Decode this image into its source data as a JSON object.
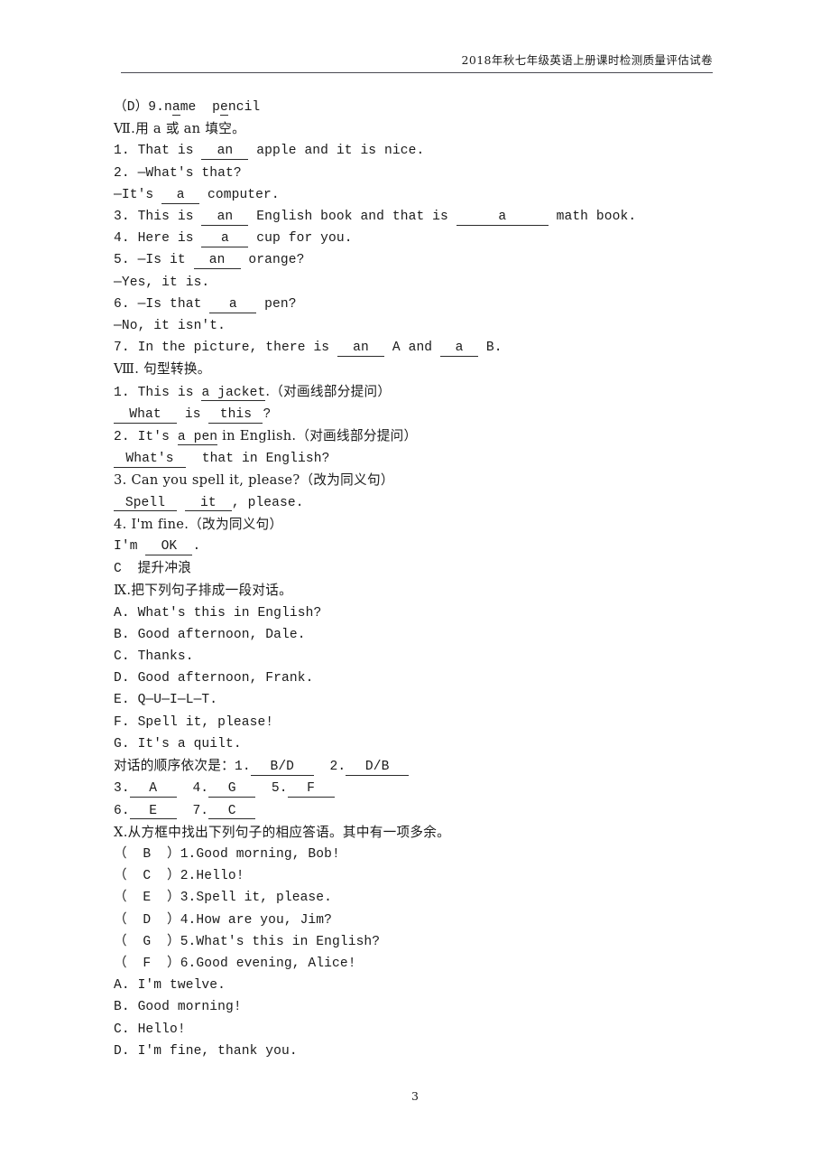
{
  "header": {
    "title": "2018年秋七年级英语上册课时检测质量评估试卷"
  },
  "footer": {
    "page_number": "3"
  },
  "content": {
    "carry_over_item": {
      "bracket_open": "（",
      "answer": "D",
      "bracket_close": "）",
      "number": "9.",
      "word1_a": "n",
      "word1_u": "a",
      "word1_b": "me",
      "word2_a": "p",
      "word2_u": "e",
      "word2_b": "ncil"
    },
    "section_7": {
      "heading": "Ⅶ.用 a 或 an 填空。",
      "items": [
        {
          "pre": "1. That is ",
          "blank": "an",
          "blank_w": "w5",
          "post": " apple and it is nice."
        },
        {
          "pre": "2. —What's that?",
          "blank": "",
          "blank_w": "",
          "post": ""
        },
        {
          "pre": "—It's ",
          "blank": "a",
          "blank_w": "w4",
          "post": " computer."
        },
        {
          "pre": "3. This is ",
          "blank": "an",
          "blank_w": "w5",
          "post": " English book and that is ",
          "blank2": "a",
          "blank2_w": "w10",
          "post2": " math book."
        },
        {
          "pre": "4. Here is ",
          "blank": "a",
          "blank_w": "w5",
          "post": " cup for you."
        },
        {
          "pre": "5. —Is it ",
          "blank": "an",
          "blank_w": "w5",
          "post": " orange?"
        },
        {
          "pre": "—Yes, it is.",
          "blank": "",
          "blank_w": "",
          "post": ""
        },
        {
          "pre": "6. —Is that ",
          "blank": "a",
          "blank_w": "w5",
          "post": " pen?"
        },
        {
          "pre": "—No, it isn't.",
          "blank": "",
          "blank_w": "",
          "post": ""
        },
        {
          "pre": "7. In the picture, there is ",
          "blank": "an",
          "blank_w": "w5",
          "post": " A and ",
          "blank2": "a",
          "blank2_w": "w4",
          "post2": " B."
        }
      ]
    },
    "section_8": {
      "heading": "Ⅷ. 句型转换。",
      "q1_prompt_pre": "1. This is ",
      "q1_prompt_ul": "a jacket",
      "q1_prompt_post": ".（对画线部分提问）",
      "q1_ans_blank1": "What",
      "q1_ans_mid": " is ",
      "q1_ans_blank2": "this",
      "q1_ans_end": "?",
      "q2_prompt_pre": "2. It's ",
      "q2_prompt_ul": "a pen",
      "q2_prompt_post": " in English.（对画线部分提问）",
      "q2_ans_blank1": "What's",
      "q2_ans_post": "  that in English?",
      "q3_prompt": "3. Can you spell it, please?（改为同义句）",
      "q3_ans_blank1": "Spell",
      "q3_ans_mid": " ",
      "q3_ans_blank2": "it",
      "q3_ans_post": ", please.",
      "q4_prompt": "4. I'm fine.（改为同义句）",
      "q4_ans_pre": "I'm ",
      "q4_ans_blank": "OK",
      "q4_ans_post": "."
    },
    "part_c": {
      "label": "C",
      "title": "提升冲浪"
    },
    "section_9": {
      "heading": "Ⅸ.把下列句子排成一段对话。",
      "options": [
        "A. What's this in English?",
        "B. Good afternoon, Dale.",
        "C. Thanks.",
        "D. Good afternoon, Frank.",
        "E. Q—U—I—L—T.",
        "F. Spell it, please!",
        "G. It's a quilt."
      ],
      "answer_label": "对话的顺序依次是：",
      "answers": [
        {
          "num": "1.",
          "value": "B/D",
          "w": "w7"
        },
        {
          "num": "2.",
          "value": "D/B",
          "w": "w7"
        },
        {
          "num": "3.",
          "value": "A",
          "w": "w5"
        },
        {
          "num": "4.",
          "value": "G",
          "w": "w5"
        },
        {
          "num": "5.",
          "value": "F",
          "w": "w5"
        },
        {
          "num": "6.",
          "value": "E",
          "w": "w5"
        },
        {
          "num": "7.",
          "value": "C",
          "w": "w5"
        }
      ]
    },
    "section_10": {
      "heading": "Ⅹ.从方框中找出下列句子的相应答语。其中有一项多余。",
      "items": [
        {
          "answer": "B",
          "number": "1.",
          "text": "Good morning, Bob!"
        },
        {
          "answer": "C",
          "number": "2.",
          "text": "Hello!"
        },
        {
          "answer": "E",
          "number": "3.",
          "text": "Spell it, please."
        },
        {
          "answer": "D",
          "number": "4.",
          "text": "How are you, Jim?"
        },
        {
          "answer": "G",
          "number": "5.",
          "text": "What's this in English?"
        },
        {
          "answer": "F",
          "number": "6.",
          "text": "Good evening, Alice!"
        }
      ],
      "bank": [
        "A. I'm twelve.",
        "B. Good morning!",
        "C. Hello!",
        "D. I'm fine, thank you."
      ]
    }
  }
}
